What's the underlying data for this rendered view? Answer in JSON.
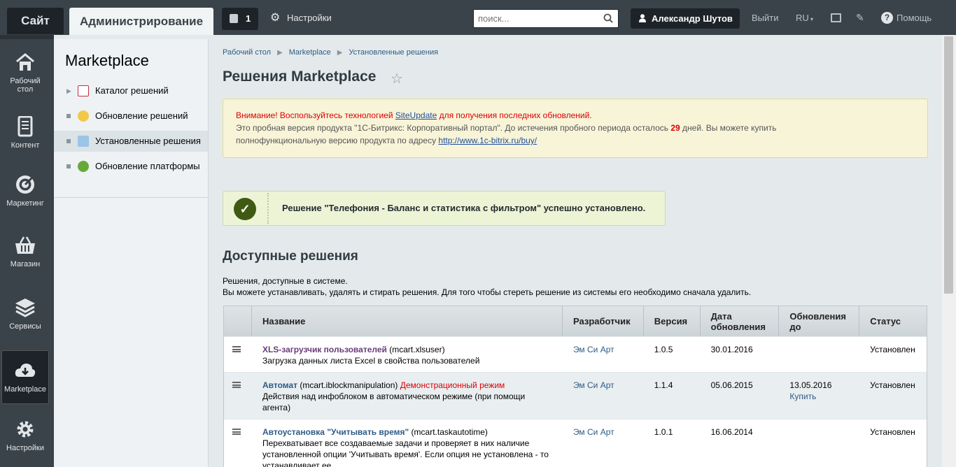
{
  "topbar": {
    "site_label": "Сайт",
    "admin_label": "Администрирование",
    "notifications_count": "1",
    "settings_label": "Настройки",
    "search_placeholder": "поиск...",
    "user_name": "Александр Шутов",
    "exit_label": "Выйти",
    "lang_label": "RU",
    "help_label": "Помощь"
  },
  "sidebar": {
    "items": [
      {
        "label": "Рабочий стол",
        "icon": "home-icon"
      },
      {
        "label": "Контент",
        "icon": "document-icon"
      },
      {
        "label": "Маркетинг",
        "icon": "target-icon"
      },
      {
        "label": "Магазин",
        "icon": "basket-icon"
      },
      {
        "label": "Сервисы",
        "icon": "layers-icon"
      },
      {
        "label": "Marketplace",
        "icon": "cloud-download-icon"
      },
      {
        "label": "Настройки",
        "icon": "gear-icon"
      }
    ]
  },
  "submenu": {
    "title": "Marketplace",
    "items": [
      {
        "label": "Каталог решений"
      },
      {
        "label": "Обновление решений"
      },
      {
        "label": "Установленные решения"
      },
      {
        "label": "Обновление платформы"
      }
    ]
  },
  "breadcrumb": [
    "Рабочий стол",
    "Marketplace",
    "Установленные решения"
  ],
  "page_title": "Решения Marketplace",
  "warning": {
    "prefix": "Внимание! Воспользуйтесь технологией ",
    "link": "SiteUpdate",
    "suffix": " для получения последних обновлений.",
    "line2_prefix": "Это пробная версия продукта \"1С-Битрикс: Корпоративный портал\". До истечения пробного периода осталось ",
    "days": "29",
    "line2_suffix": " дней. Вы можете купить",
    "line3_prefix": "полнофункциональную версию продукта по адресу ",
    "url": "http://www.1c-bitrix.ru/buy/"
  },
  "success_message": "Решение \"Телефония - Баланс и статистика с фильтром\" успешно установлено.",
  "available": {
    "title": "Доступные решения",
    "desc1": "Решения, доступные в системе.",
    "desc2": "Вы можете устанавливать, удалять и стирать решения. Для того чтобы стереть решение из системы его необходимо сначала удалить."
  },
  "table": {
    "headers": [
      "Название",
      "Разработчик",
      "Версия",
      "Дата обновления",
      "Обновления до",
      "Статус"
    ],
    "rows": [
      {
        "name": "XLS-загрузчик пользователей",
        "code": " (mcart.xlsuser)",
        "demo": "",
        "desc": "Загрузка данных листа Excel в свойства пользователей",
        "developer": "Эм Си Арт",
        "version": "1.0.5",
        "date": "30.01.2016",
        "updates_until": "",
        "buy": "",
        "status": "Установлен"
      },
      {
        "name": "Автомат",
        "code": " (mcart.iblockmanipulation) ",
        "demo": "Демонстрационный режим",
        "desc": "Действия над инфоблоком в автоматическом режиме (при помощи агента)",
        "developer": "Эм Си Арт",
        "version": "1.1.4",
        "date": "05.06.2015",
        "updates_until": "13.05.2016",
        "buy": "Купить",
        "status": "Установлен"
      },
      {
        "name": "Автоустановка \"Учитывать время\"",
        "code": " (mcart.taskautotime)",
        "demo": "",
        "desc": "Перехватывает все создаваемые задачи и проверяет в них наличие установленной опции 'Учитывать время'. Если опция не установлена - то устанавливает ее",
        "developer": "Эм Си Арт",
        "version": "1.0.1",
        "date": "16.06.2014",
        "updates_until": "",
        "buy": "",
        "status": "Установлен"
      }
    ]
  }
}
